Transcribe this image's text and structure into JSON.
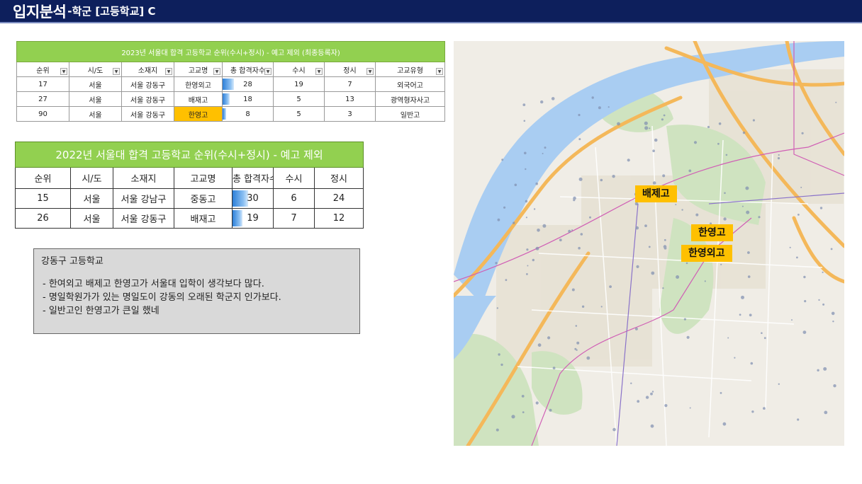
{
  "header": {
    "title_main": "입지분석",
    "title_sub": "-학군 [고등학교] C"
  },
  "table2023": {
    "caption": "2023년 서울대 합격 고등학교 순위(수시+정시) - 예고 제외 (최종등록자)",
    "columns": [
      "순위",
      "시/도",
      "소재지",
      "고교명",
      "총 합격자수",
      "수시",
      "정시",
      "고교유형"
    ],
    "rows": [
      {
        "rank": "17",
        "sido": "서울",
        "location": "서울 강동구",
        "school": "한영외고",
        "total": 28,
        "susi": "19",
        "jeongsi": "7",
        "type": "외국어고",
        "highlight": false
      },
      {
        "rank": "27",
        "sido": "서울",
        "location": "서울 강동구",
        "school": "배재고",
        "total": 18,
        "susi": "5",
        "jeongsi": "13",
        "type": "광역형자사고",
        "highlight": false
      },
      {
        "rank": "90",
        "sido": "서울",
        "location": "서울 강동구",
        "school": "한영고",
        "total": 8,
        "susi": "5",
        "jeongsi": "3",
        "type": "일반고",
        "highlight": true
      }
    ],
    "highlight_color": "#ffc000"
  },
  "table2022": {
    "caption": "2022년 서울대 합격 고등학교 순위(수시+정시) - 예고 제외",
    "columns": [
      "순위",
      "시/도",
      "소재지",
      "고교명",
      "총 합격자수",
      "수시",
      "정시"
    ],
    "rows": [
      {
        "rank": "15",
        "sido": "서울",
        "location": "서울 강남구",
        "school": "중동고",
        "total": 30,
        "susi": "6",
        "jeongsi": "24"
      },
      {
        "rank": "26",
        "sido": "서울",
        "location": "서울 강동구",
        "school": "배재고",
        "total": 19,
        "susi": "7",
        "jeongsi": "12"
      }
    ]
  },
  "note": {
    "title": "강동구 고등학교",
    "items": [
      "-  한여외고 배제고 한영고가 서울대 입학이 생각보다 많다.",
      "-  명일학원가가 있는 명일도이 강동의 오래된 학군지 인가보다.",
      "-  일반고인 한영고가 큰일 했네"
    ]
  },
  "map": {
    "labels": {
      "baejae": "배제고",
      "hanyoung": "한영고",
      "hanyoung_foreign": "한영외고"
    },
    "label_color": "#ffc000"
  },
  "colors": {
    "title_bar": "#0d1f5c",
    "table_header_green": "#92d050",
    "note_bg": "#d9d9d9"
  }
}
